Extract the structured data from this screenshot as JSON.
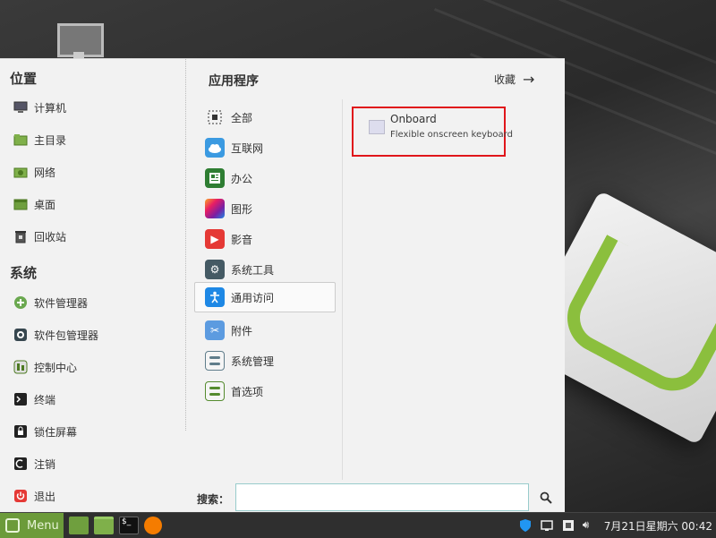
{
  "places": {
    "title": "位置",
    "items": [
      {
        "label": "计算机",
        "icon": "computer-icon"
      },
      {
        "label": "主目录",
        "icon": "home-folder-icon"
      },
      {
        "label": "网络",
        "icon": "network-folder-icon"
      },
      {
        "label": "桌面",
        "icon": "desktop-folder-icon"
      },
      {
        "label": "回收站",
        "icon": "trash-icon"
      }
    ]
  },
  "system": {
    "title": "系统",
    "items": [
      {
        "label": "软件管理器",
        "icon": "software-manager-icon"
      },
      {
        "label": "软件包管理器",
        "icon": "package-manager-icon"
      },
      {
        "label": "控制中心",
        "icon": "control-center-icon"
      },
      {
        "label": "终端",
        "icon": "terminal-icon"
      },
      {
        "label": "锁住屏幕",
        "icon": "lock-icon"
      },
      {
        "label": "注销",
        "icon": "logout-icon"
      },
      {
        "label": "退出",
        "icon": "power-icon"
      }
    ]
  },
  "apps": {
    "title": "应用程序",
    "favorites_label": "收藏",
    "categories": [
      {
        "label": "全部",
        "icon": "all-apps-icon",
        "color": "#ffffff"
      },
      {
        "label": "互联网",
        "icon": "internet-cloud-icon",
        "color": "#3b9ae1"
      },
      {
        "label": "办公",
        "icon": "office-icon",
        "color": "#2e7d32"
      },
      {
        "label": "图形",
        "icon": "graphics-icon",
        "color": "#c0399b"
      },
      {
        "label": "影音",
        "icon": "multimedia-play-icon",
        "color": "#e53935"
      },
      {
        "label": "系统工具",
        "icon": "system-tools-gear-icon",
        "color": "#455a64"
      },
      {
        "label": "通用访问",
        "icon": "accessibility-icon",
        "color": "#1e88e5",
        "selected": true
      },
      {
        "label": "附件",
        "icon": "accessories-scissors-icon",
        "color": "#5c9be0"
      },
      {
        "label": "系统管理",
        "icon": "administration-icon",
        "color": "#607d8b"
      },
      {
        "label": "首选项",
        "icon": "preferences-icon",
        "color": "#558b2f"
      }
    ],
    "entries": [
      {
        "name": "Onboard",
        "description": "Flexible onscreen keyboard"
      }
    ]
  },
  "search": {
    "label": "搜索：",
    "value": ""
  },
  "taskbar": {
    "menu_label": "Menu",
    "clock": "7月21日星期六 00:42"
  },
  "colors": {
    "accent": "#6c9b3a",
    "highlight_box": "#e0161b"
  }
}
